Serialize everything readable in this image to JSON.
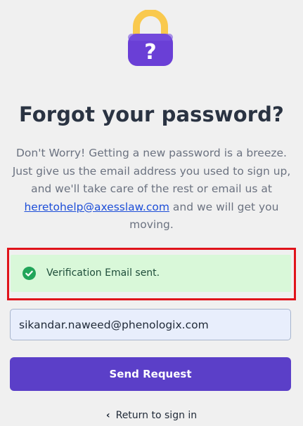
{
  "lock_icon": {
    "name": "padlock-question-icon",
    "glyph": "?"
  },
  "title": "Forgot your password?",
  "description": {
    "before_link": "Don't Worry! Getting a new password is a breeze. Just give us the email address you used to sign up, and we'll take care of the rest or email us at ",
    "link": "heretohelp@axesslaw.com",
    "after_link": " and we will get you moving."
  },
  "alert": {
    "icon": "check-circle-icon",
    "text": "Verification Email sent."
  },
  "email_field": {
    "value": "sikandar.naweed@phenologix.com"
  },
  "send_button": {
    "label": "Send Request"
  },
  "return_link": {
    "icon": "chevron-left-icon",
    "chevron": "‹",
    "label": "Return to sign in"
  },
  "colors": {
    "accent": "#5b3fc8",
    "lock_shackle": "#f9c94e",
    "lock_body": "#6a3fd6",
    "success_bg": "#d9f8d9",
    "success_icon": "#22a55a",
    "highlight_border": "#e0131b",
    "link": "#1d4ed8"
  }
}
